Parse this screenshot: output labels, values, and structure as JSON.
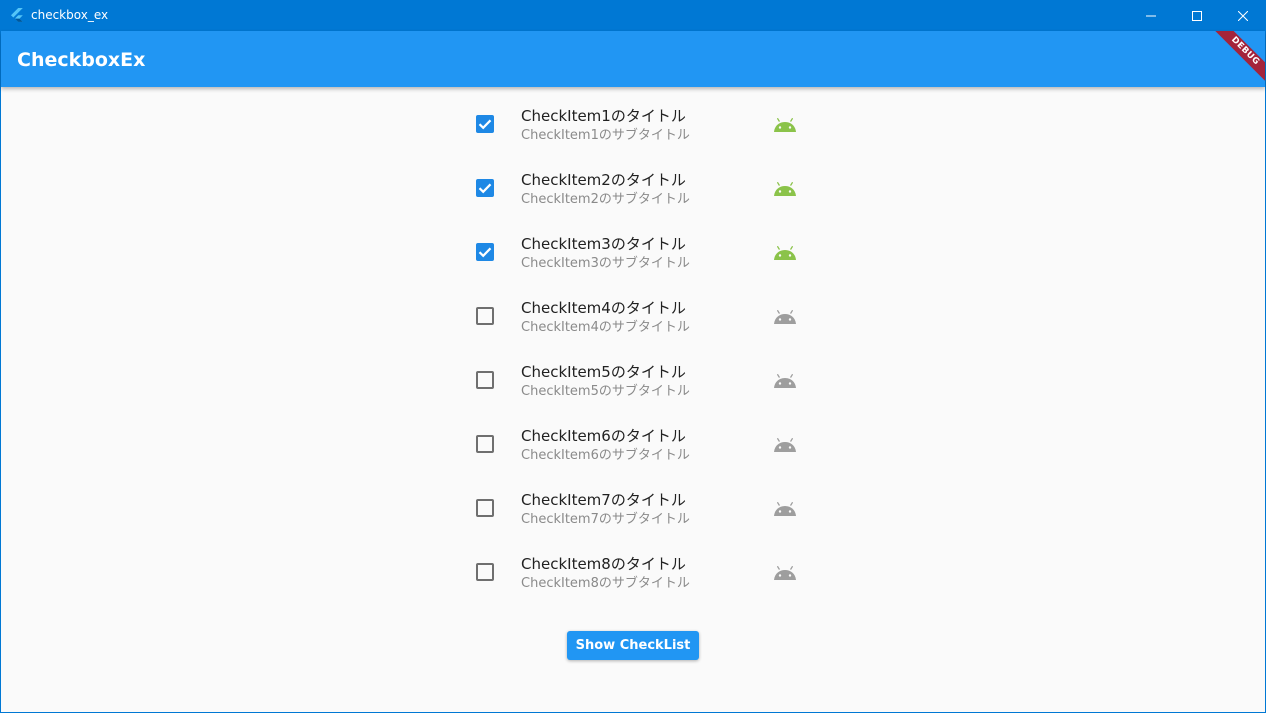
{
  "window": {
    "title": "checkbox_ex"
  },
  "appbar": {
    "title": "CheckboxEx"
  },
  "debug_banner": {
    "label": "DEBUG"
  },
  "items": [
    {
      "title": "CheckItem1のタイトル",
      "subtitle": "CheckItem1のサブタイトル",
      "checked": true
    },
    {
      "title": "CheckItem2のタイトル",
      "subtitle": "CheckItem2のサブタイトル",
      "checked": true
    },
    {
      "title": "CheckItem3のタイトル",
      "subtitle": "CheckItem3のサブタイトル",
      "checked": true
    },
    {
      "title": "CheckItem4のタイトル",
      "subtitle": "CheckItem4のサブタイトル",
      "checked": false
    },
    {
      "title": "CheckItem5のタイトル",
      "subtitle": "CheckItem5のサブタイトル",
      "checked": false
    },
    {
      "title": "CheckItem6のタイトル",
      "subtitle": "CheckItem6のサブタイトル",
      "checked": false
    },
    {
      "title": "CheckItem7のタイトル",
      "subtitle": "CheckItem7のサブタイトル",
      "checked": false
    },
    {
      "title": "CheckItem8のタイトル",
      "subtitle": "CheckItem8のサブタイトル",
      "checked": false
    }
  ],
  "show_button": {
    "label": "Show CheckList"
  },
  "colors": {
    "titlebar": "#0078d4",
    "appbar": "#2196f3",
    "checkbox_checked": "#1e88e5",
    "icon_active": "#8bc34a",
    "icon_inactive": "#9e9e9e",
    "debug_ribbon": "#a4243b"
  },
  "icons": {
    "app": "flutter-logo-icon",
    "item": "android-icon",
    "minimize": "minimize-icon",
    "maximize": "maximize-icon",
    "close": "close-icon"
  }
}
